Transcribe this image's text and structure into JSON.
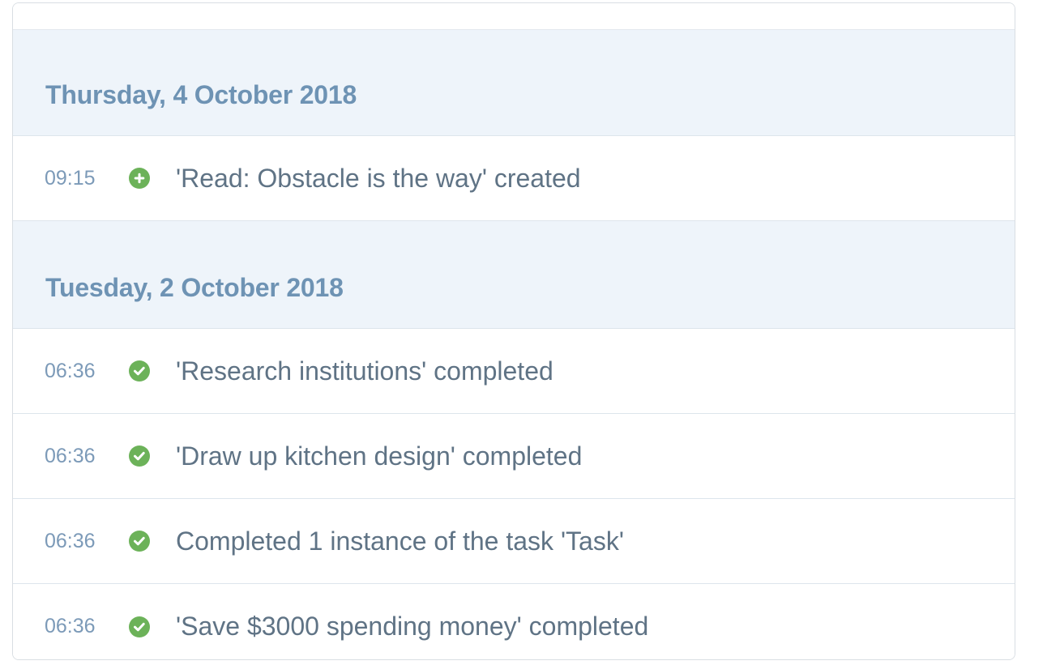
{
  "activity": {
    "groups": [
      {
        "date": "Thursday, 4 October 2018",
        "events": [
          {
            "time": "09:15",
            "icon": "plus-circle-icon",
            "text": "'Read: Obstacle is the way' created"
          }
        ]
      },
      {
        "date": "Tuesday, 2 October 2018",
        "events": [
          {
            "time": "06:36",
            "icon": "check-circle-icon",
            "text": "'Research institutions' completed"
          },
          {
            "time": "06:36",
            "icon": "check-circle-icon",
            "text": "'Draw up kitchen design' completed"
          },
          {
            "time": "06:36",
            "icon": "check-circle-icon",
            "text": "Completed 1 instance of the task 'Task'"
          },
          {
            "time": "06:36",
            "icon": "check-circle-icon",
            "text": "'Save $3000 spending money' completed"
          }
        ]
      }
    ]
  },
  "colors": {
    "header_bg": "#eef4fa",
    "header_text": "#6e93b4",
    "time_text": "#7c9ab8",
    "event_text": "#5f7385",
    "success_green": "#6cb259"
  }
}
